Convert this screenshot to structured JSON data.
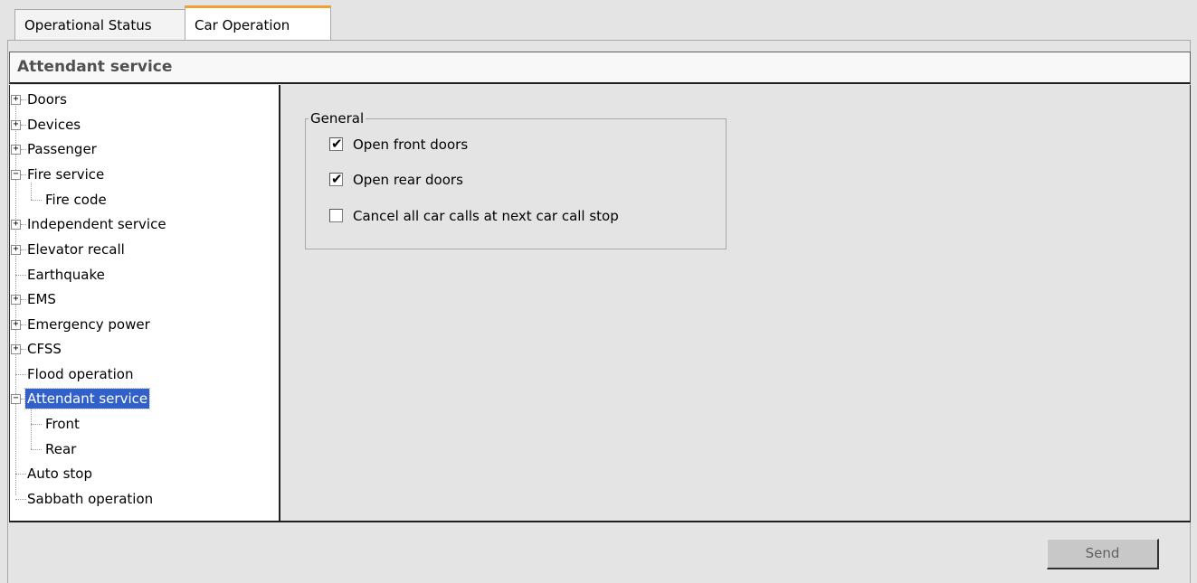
{
  "tabs": [
    {
      "label": "Operational Status",
      "active": false
    },
    {
      "label": "Car Operation",
      "active": true
    }
  ],
  "panel_title": "Attendant service",
  "tree": {
    "doors": "Doors",
    "devices": "Devices",
    "passenger": "Passenger",
    "fire_service": "Fire service",
    "fire_code": "Fire code",
    "independent_service": "Independent service",
    "elevator_recall": "Elevator recall",
    "earthquake": "Earthquake",
    "ems": "EMS",
    "emergency_power": "Emergency power",
    "cfss": "CFSS",
    "flood_operation": "Flood operation",
    "attendant_service": "Attendant service",
    "front": "Front",
    "rear": "Rear",
    "auto_stop": "Auto stop",
    "sabbath_operation": "Sabbath operation"
  },
  "general": {
    "legend": "General",
    "options": [
      {
        "label": "Open front doors",
        "checked": true
      },
      {
        "label": "Open rear doors",
        "checked": true
      },
      {
        "label": "Cancel all car calls at next car call stop",
        "checked": false
      }
    ]
  },
  "send_label": "Send",
  "icons": {
    "expand": "plus-box-icon",
    "collapse": "minus-box-icon",
    "check": "check-icon"
  },
  "colors": {
    "selection": "#3060c8",
    "active_tab_accent": "#f0a030"
  }
}
